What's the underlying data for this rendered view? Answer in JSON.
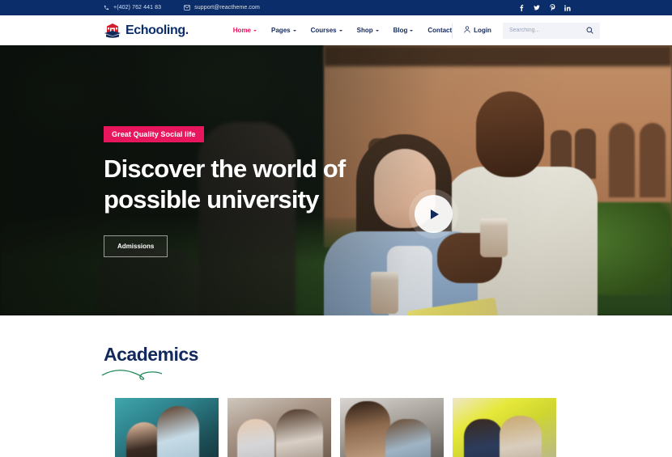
{
  "topbar": {
    "phone": "+(402) 762 441 83",
    "phone_icon": "phone-icon",
    "email": "support@reactheme.com",
    "email_icon": "mail-icon",
    "socials": [
      {
        "name": "facebook-icon",
        "glyph": "f"
      },
      {
        "name": "twitter-icon",
        "glyph": "t"
      },
      {
        "name": "pinterest-icon",
        "glyph": "P"
      },
      {
        "name": "linkedin-icon",
        "glyph": "in"
      }
    ],
    "bg_color": "#0b2e6b"
  },
  "header": {
    "brand": "Echooling.",
    "brand_icon": "school-building-icon",
    "nav": [
      {
        "label": "Home",
        "has_caret": true,
        "active": true
      },
      {
        "label": "Pages",
        "has_caret": true,
        "active": false
      },
      {
        "label": "Courses",
        "has_caret": true,
        "active": false
      },
      {
        "label": "Shop",
        "has_caret": true,
        "active": false
      },
      {
        "label": "Blog",
        "has_caret": true,
        "active": false
      },
      {
        "label": "Contact",
        "has_caret": false,
        "active": false
      }
    ],
    "login_label": "Login",
    "login_icon": "user-icon",
    "search": {
      "value": "",
      "placeholder": "Searching...",
      "icon": "search-icon"
    },
    "active_color": "#e8175d",
    "text_color": "#12295c"
  },
  "hero": {
    "badge": "Great Quality Social life",
    "title_line1": "Discover the world of",
    "title_line2": "possible university",
    "button_label": "Admissions",
    "play_icon": "play-icon",
    "badge_color": "#e8175d"
  },
  "academics": {
    "title": "Academics",
    "title_color": "#12295c",
    "underline_color": "#1f8a5a",
    "cards": [
      {
        "name": "academics-card-1",
        "alt": "Two students studying on campus porch"
      },
      {
        "name": "academics-card-2",
        "alt": "Three students talking in courtyard"
      },
      {
        "name": "academics-card-3",
        "alt": "Two students sitting on steps"
      },
      {
        "name": "academics-card-4",
        "alt": "Two students working in classroom"
      }
    ]
  }
}
